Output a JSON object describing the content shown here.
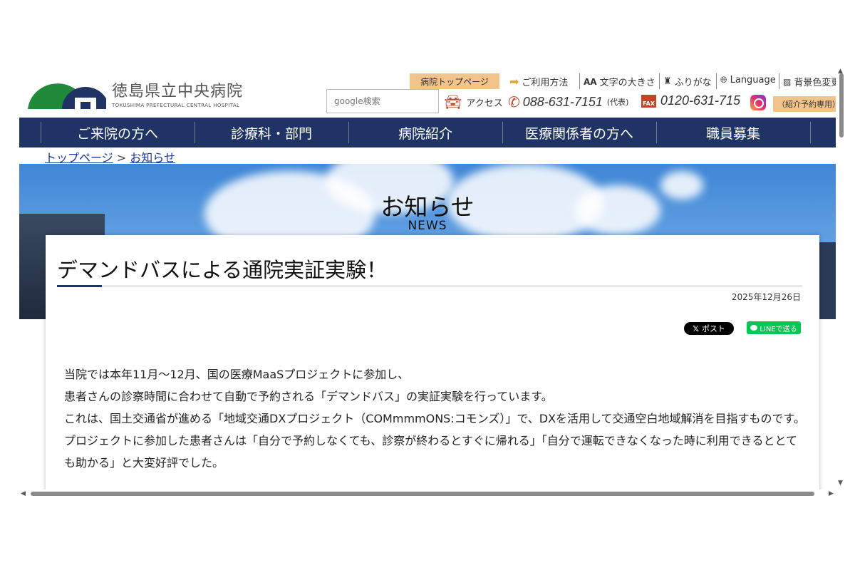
{
  "header": {
    "logo_jp": "徳島県立中央病院",
    "logo_en": "TOKUSHIMA PREFECTURAL CENTRAL HOSPITAL",
    "hospital_top": "病院トップページ",
    "usage": "ご利用方法",
    "font_size": "文字の大きさ",
    "font_size_prefix": "AA",
    "furigana": "ふりがな",
    "language": "Language",
    "bg_color": "背景色変更",
    "search_placeholder": "google検索",
    "access": "アクセス",
    "tel_main": "088-631-7151",
    "tel_main_note": "(代表)",
    "fax_badge": "FAX",
    "tel_free": "0120-631-715",
    "referral": "（紹介予約専用）"
  },
  "nav": {
    "items": [
      "ご来院の方へ",
      "診療科・部門",
      "病院紹介",
      "医療関係者の方へ",
      "職員募集"
    ]
  },
  "breadcrumb": {
    "home": "トップページ",
    "sep": ">",
    "current": "お知らせ"
  },
  "hero": {
    "title": "お知らせ",
    "subtitle": "NEWS"
  },
  "article": {
    "title": "デマンドバスによる通院実証実験！",
    "date": "2025年12月26日",
    "share_x": "ポスト",
    "share_line": "LINEで送る",
    "paragraphs": [
      "当院では本年11月〜12月、国の医療MaaSプロジェクトに参加し、",
      "患者さんの診察時間に合わせて自動で予約される「デマンドバス」の実証実験を行っています。",
      "これは、国土交通省が進める「地域交通DXプロジェクト（COMmmmONS:コモンズ）」で、DXを活用して交通空白地域解消を目指すものです。",
      "プロジェクトに参加した患者さんは「自分で予約しなくても、診察が終わるとすぐに帰れる」「自分で運転できなくなった時に利用できるととても助かる」と大変好評でした。"
    ]
  },
  "colors": {
    "nav_bg": "#1f3464",
    "accent_tag": "#f2c38b",
    "logo_green": "#1f8a3a",
    "line_green": "#06c755"
  }
}
